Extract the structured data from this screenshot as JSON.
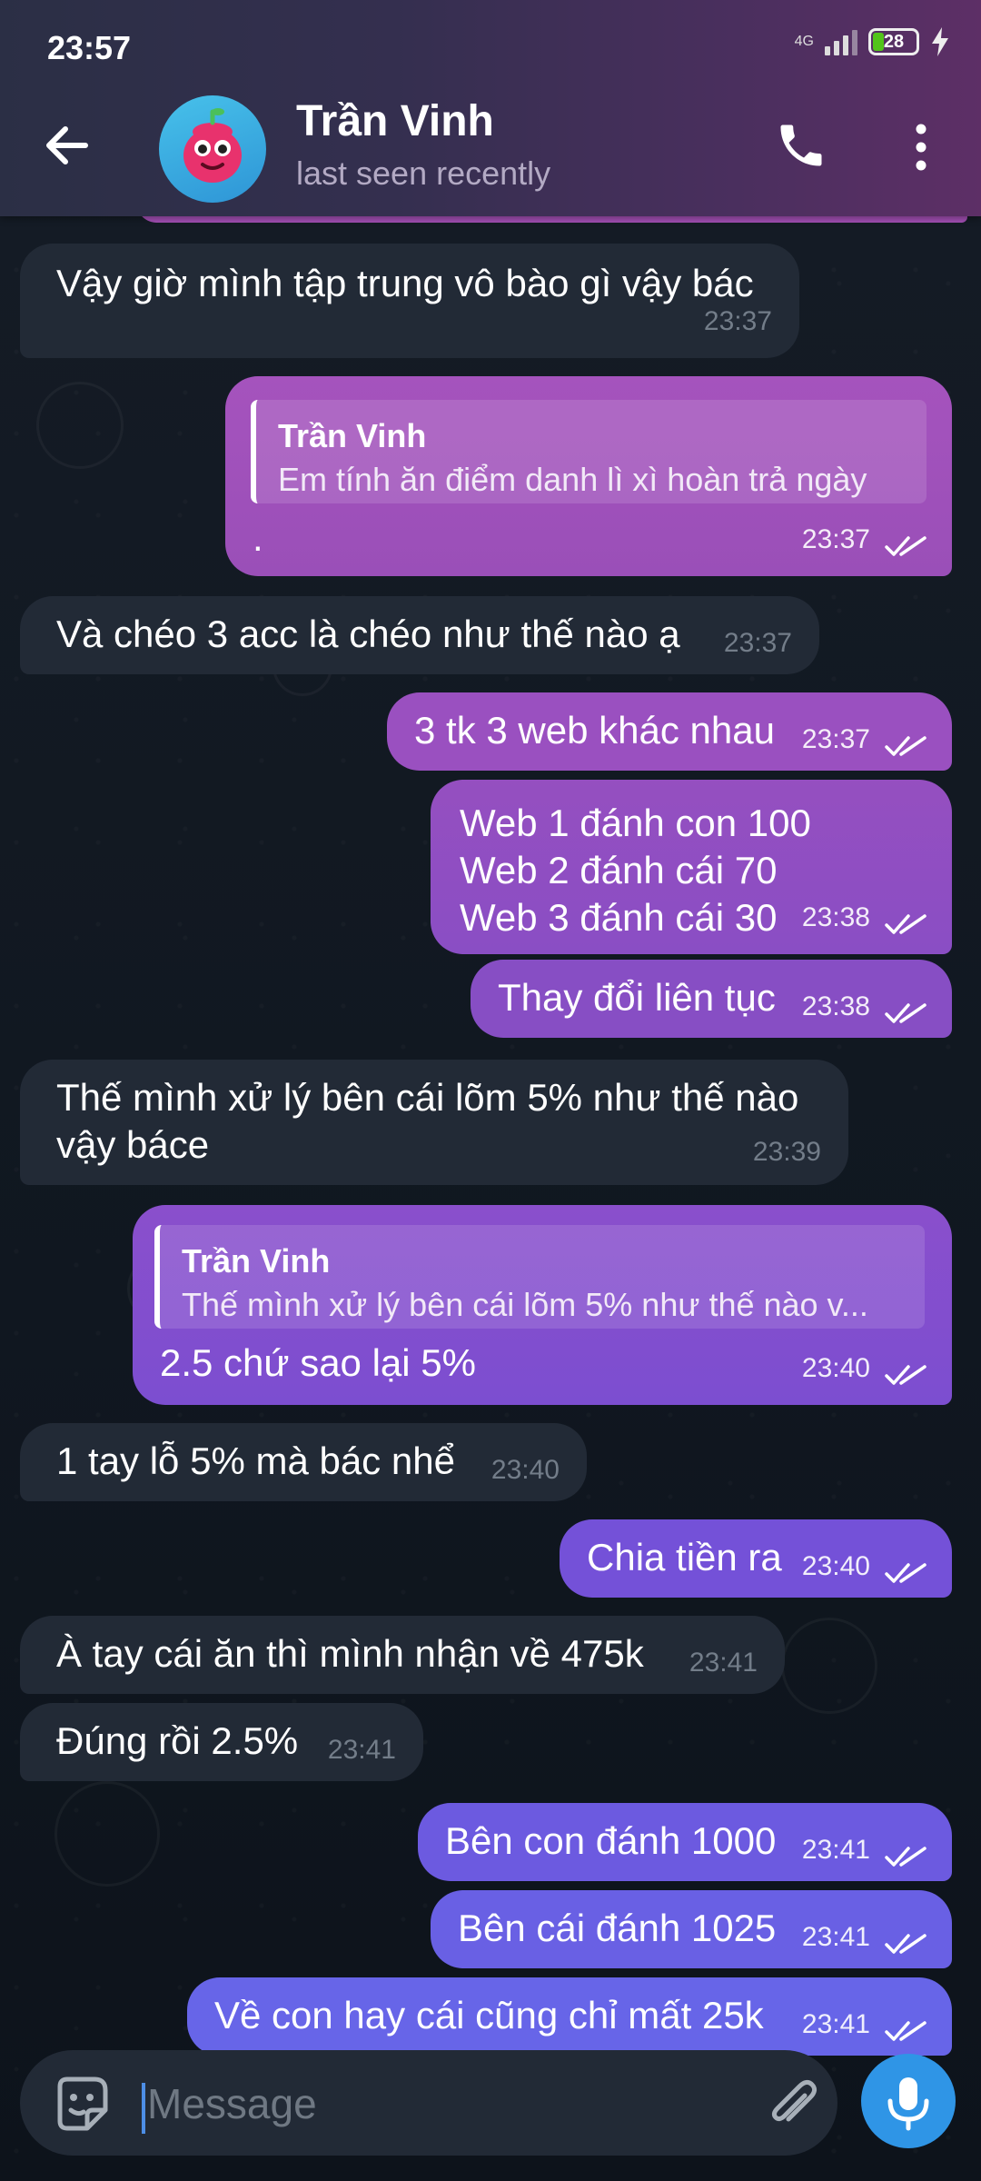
{
  "status_bar": {
    "time": "23:57",
    "network": "4G",
    "battery": "28"
  },
  "header": {
    "name": "Trần Vinh",
    "subtitle": "last seen recently"
  },
  "messages": [
    {
      "dir": "in",
      "text": "Vậy giờ mình tập trung vô bào gì vậy bác",
      "time": "23:37"
    },
    {
      "dir": "out",
      "reply_name": "Trần Vinh",
      "reply_text": "Em tính ăn điểm danh lì xì hoàn trả ngày",
      "text": ".",
      "time": "23:37"
    },
    {
      "dir": "in",
      "text": "Và chéo 3 acc là chéo như thế nào ạ",
      "time": "23:37"
    },
    {
      "dir": "out",
      "text": "3 tk 3 web khác nhau",
      "time": "23:37"
    },
    {
      "dir": "out",
      "lines": [
        "Web 1 đánh con 100",
        "Web 2 đánh cái 70",
        "Web 3 đánh cái 30"
      ],
      "time": "23:38"
    },
    {
      "dir": "out",
      "text": "Thay đổi liên tục",
      "time": "23:38"
    },
    {
      "dir": "in",
      "lines": [
        "Thế mình xử lý bên cái lõm 5% như thế nào",
        "vậy báce"
      ],
      "time": "23:39"
    },
    {
      "dir": "out",
      "reply_name": "Trần Vinh",
      "reply_text": "Thế mình xử lý bên cái lõm 5% như thế nào v...",
      "text": "2.5 chứ sao lại 5%",
      "time": "23:40"
    },
    {
      "dir": "in",
      "text": "1 tay lỗ 5% mà bác nhể",
      "time": "23:40"
    },
    {
      "dir": "out",
      "text": "Chia tiền ra",
      "time": "23:40"
    },
    {
      "dir": "in",
      "text": "À tay cái ăn thì mình nhận về 475k",
      "time": "23:41"
    },
    {
      "dir": "in",
      "text": "Đúng rồi 2.5%",
      "time": "23:41"
    },
    {
      "dir": "out",
      "text": "Bên con đánh 1000",
      "time": "23:41"
    },
    {
      "dir": "out",
      "text": "Bên cái đánh 1025",
      "time": "23:41"
    },
    {
      "dir": "out",
      "text": "Về con hay cái cũng chỉ mất 25k",
      "time": "23:41"
    }
  ],
  "input": {
    "placeholder": "Message"
  },
  "icons": {
    "back": "arrow-left-icon",
    "call": "phone-icon",
    "more": "more-vertical-icon",
    "emoji": "emoji-icon",
    "attach": "paperclip-icon",
    "mic": "microphone-icon",
    "read": "double-check-icon"
  },
  "colors": {
    "incoming_bubble": "#222a36",
    "outgoing_top": "#9b4fb8",
    "outgoing_bottom": "#6a63e8",
    "accent": "#2f95e6"
  }
}
